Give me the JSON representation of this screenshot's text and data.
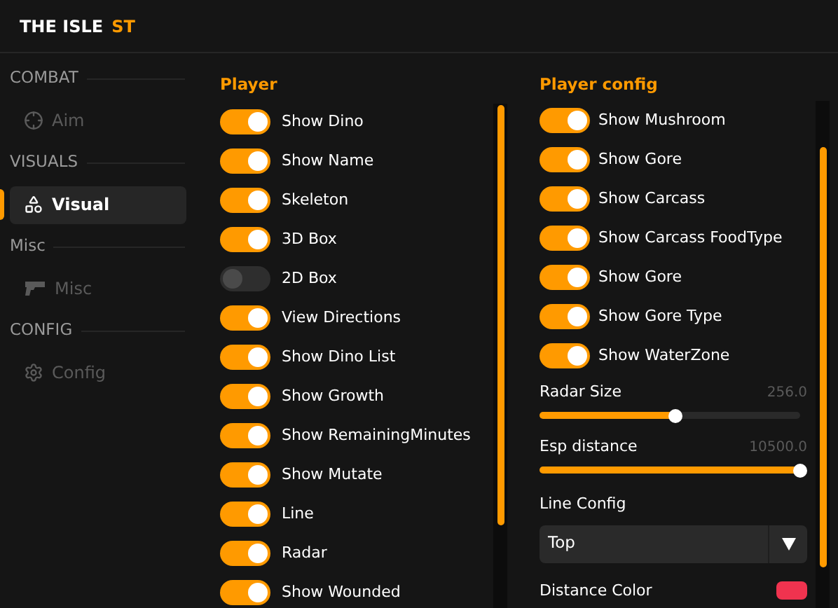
{
  "header": {
    "title": "THE ISLE",
    "suffix": "ST"
  },
  "sidebar": [
    {
      "title": "COMBAT",
      "items": [
        {
          "label": "Aim",
          "selected": false
        }
      ]
    },
    {
      "title": "VISUALS",
      "items": [
        {
          "label": "Visual",
          "selected": true
        }
      ]
    },
    {
      "title": "Misc",
      "items": [
        {
          "label": "Misc",
          "selected": false
        }
      ]
    },
    {
      "title": "CONFIG",
      "items": [
        {
          "label": "Config",
          "selected": false
        }
      ]
    }
  ],
  "player": {
    "title": "Player",
    "toggles": [
      {
        "label": "Show Dino",
        "on": true
      },
      {
        "label": "Show Name",
        "on": true
      },
      {
        "label": "Skeleton",
        "on": true
      },
      {
        "label": "3D Box",
        "on": true
      },
      {
        "label": "2D Box",
        "on": false
      },
      {
        "label": "View Directions",
        "on": true
      },
      {
        "label": "Show Dino List",
        "on": true
      },
      {
        "label": "Show Growth",
        "on": true
      },
      {
        "label": "Show RemainingMinutes",
        "on": true
      },
      {
        "label": "Show Mutate",
        "on": true
      },
      {
        "label": "Line",
        "on": true
      },
      {
        "label": "Radar",
        "on": true
      },
      {
        "label": "Show Wounded",
        "on": true
      }
    ]
  },
  "player_config": {
    "title": "Player config",
    "items": [
      {
        "kind": "toggle",
        "label": "Show Mushroom",
        "on": true
      },
      {
        "kind": "toggle",
        "label": "Show Gore",
        "on": true
      },
      {
        "kind": "toggle",
        "label": "Show Carcass",
        "on": true
      },
      {
        "kind": "toggle",
        "label": "Show Carcass FoodType",
        "on": true
      },
      {
        "kind": "toggle",
        "label": "Show Gore",
        "on": true
      },
      {
        "kind": "toggle",
        "label": "Show Gore Type",
        "on": true
      },
      {
        "kind": "toggle",
        "label": "Show WaterZone",
        "on": true
      },
      {
        "kind": "slider",
        "label": "Radar Size",
        "reading": "256.0",
        "level": 0.52
      },
      {
        "kind": "slider",
        "label": "Esp distance",
        "reading": "10500.0",
        "level": 1.0
      },
      {
        "kind": "select",
        "label": "Line Config",
        "value": "Top"
      },
      {
        "kind": "color",
        "label": "Distance Color",
        "color": "#f0334f"
      }
    ]
  }
}
